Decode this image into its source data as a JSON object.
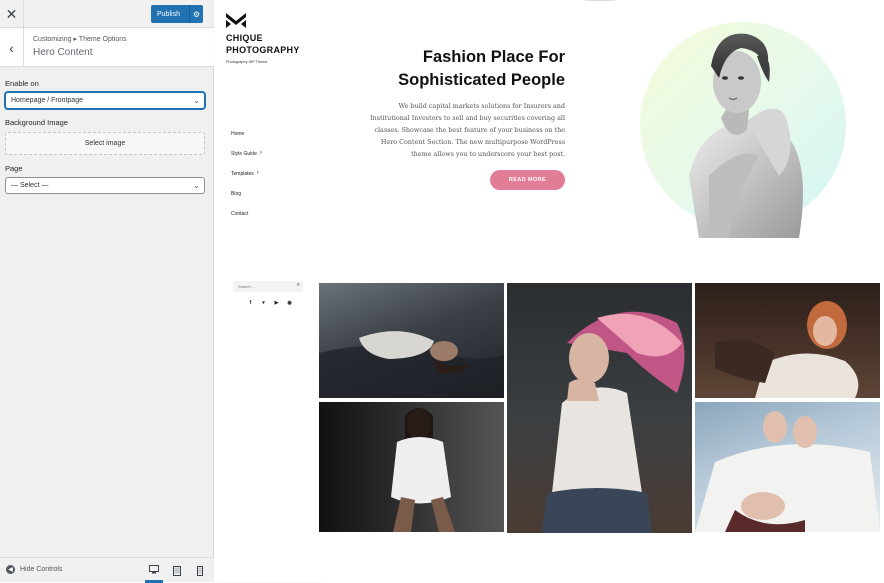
{
  "customizer": {
    "publish_label": "Publish",
    "breadcrumb": "Customizing ▸ Theme Options",
    "section_title": "Hero Content",
    "enable_on_label": "Enable on",
    "enable_on_value": "Homepage / Frontpage",
    "background_image_label": "Background Image",
    "select_image_label": "Select image",
    "page_label": "Page",
    "page_value": "— Select —",
    "hide_controls_label": "Hide Controls",
    "accent_color": "#2271b1"
  },
  "site": {
    "title": "CHIQUE PHOTOGRAPHY",
    "tagline": "Photography WP Theme",
    "nav": [
      {
        "label": "Home",
        "has_submenu": false
      },
      {
        "label": "Style Guide",
        "has_submenu": true
      },
      {
        "label": "Templates",
        "has_submenu": true
      },
      {
        "label": "Blog",
        "has_submenu": false
      },
      {
        "label": "Contact",
        "has_submenu": false
      }
    ],
    "search_placeholder": "Search ...",
    "socials": [
      "facebook-icon",
      "twitter-icon",
      "youtube-icon",
      "dribbble-icon"
    ]
  },
  "hero": {
    "title": "Fashion Place For Sophisticated People",
    "text": "We build capital markets solutions for Insurers and Institutional Investors to sell and buy securities covering all classes. Showcase the best feature of your business on the Hero Content Section. The new multipurpose WordPress theme allows you to underscore your best post.",
    "button_label": "READ MORE",
    "button_color": "#e27d97"
  }
}
